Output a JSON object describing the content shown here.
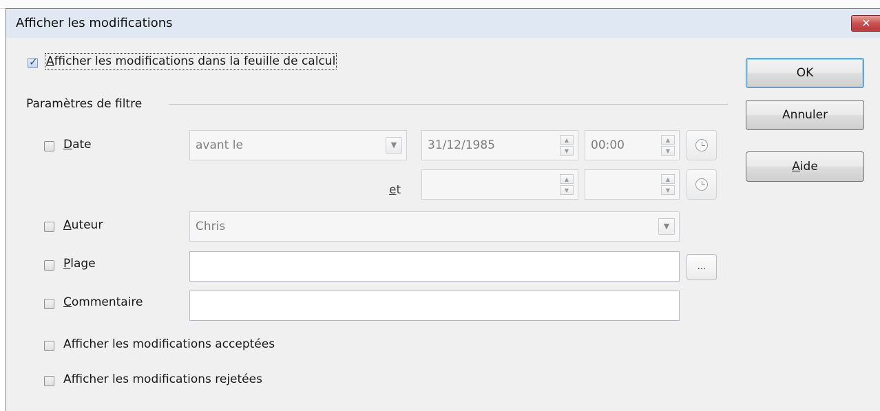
{
  "dialog": {
    "title": "Afficher les modifications",
    "close_glyph": "✕"
  },
  "show_changes": {
    "label": "Afficher les modifications dans la feuille de calcul",
    "checked": true
  },
  "filter_section": {
    "title": "Paramètres de filtre"
  },
  "date": {
    "label": "Date",
    "checked": false,
    "condition": "avant le",
    "date_value": "31/12/1985",
    "time_value": "00:00",
    "and_label": "et",
    "date2_value": "",
    "time2_value": ""
  },
  "author": {
    "label": "Auteur",
    "checked": false,
    "value": "Chris"
  },
  "range": {
    "label": "Plage",
    "checked": false,
    "value": "",
    "ellipsis": "..."
  },
  "comment": {
    "label": "Commentaire",
    "checked": false,
    "value": ""
  },
  "show_accepted": {
    "label": "Afficher les modifications acceptées",
    "checked": false
  },
  "show_rejected": {
    "label": "Afficher les modifications rejetées",
    "checked": false
  },
  "buttons": {
    "ok": "OK",
    "cancel": "Annuler",
    "help": "Aide"
  },
  "icons": {
    "checkbox_tick": "check-icon",
    "spin": "spin-arrows-icon",
    "clock": "clock-icon",
    "dropdown": "chevron-down-icon",
    "close": "close-icon"
  },
  "colors": {
    "dialog_bg": "#f0f0f0",
    "titlebar_bg": "#dfe8f3",
    "close_red": "#c75050",
    "default_button_border": "#3c7fb1"
  }
}
